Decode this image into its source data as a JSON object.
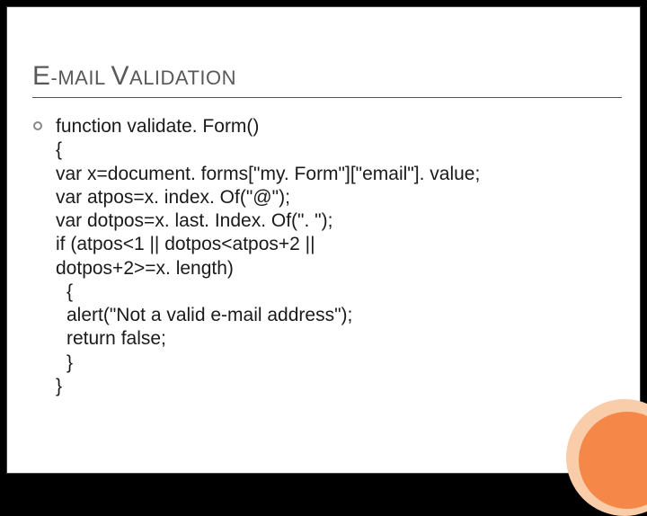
{
  "title": {
    "segments": [
      {
        "text": "E",
        "class": "cap"
      },
      {
        "text": "-MAIL ",
        "class": "sm"
      },
      {
        "text": "V",
        "class": "cap"
      },
      {
        "text": "ALIDATION",
        "class": "sm"
      }
    ]
  },
  "code_lines": [
    {
      "text": "function validate. Form()",
      "indent": false
    },
    {
      "text": "{",
      "indent": false
    },
    {
      "text": "var x=document. forms[\"my. Form\"][\"email\"]. value;",
      "indent": false
    },
    {
      "text": "var atpos=x. index. Of(\"@\");",
      "indent": false
    },
    {
      "text": "var dotpos=x. last. Index. Of(\". \");",
      "indent": false
    },
    {
      "text": "if (atpos<1 || dotpos<atpos+2 ||",
      "indent": false
    },
    {
      "text": "dotpos+2>=x. length)",
      "indent": false
    },
    {
      "text": "{",
      "indent": true
    },
    {
      "text": "alert(\"Not a valid e-mail address\");",
      "indent": true
    },
    {
      "text": "return false;",
      "indent": true
    },
    {
      "text": "}",
      "indent": true
    },
    {
      "text": "}",
      "indent": false
    }
  ],
  "colors": {
    "accent_ring": "#f9ccaa",
    "accent_fill": "#f58848"
  }
}
